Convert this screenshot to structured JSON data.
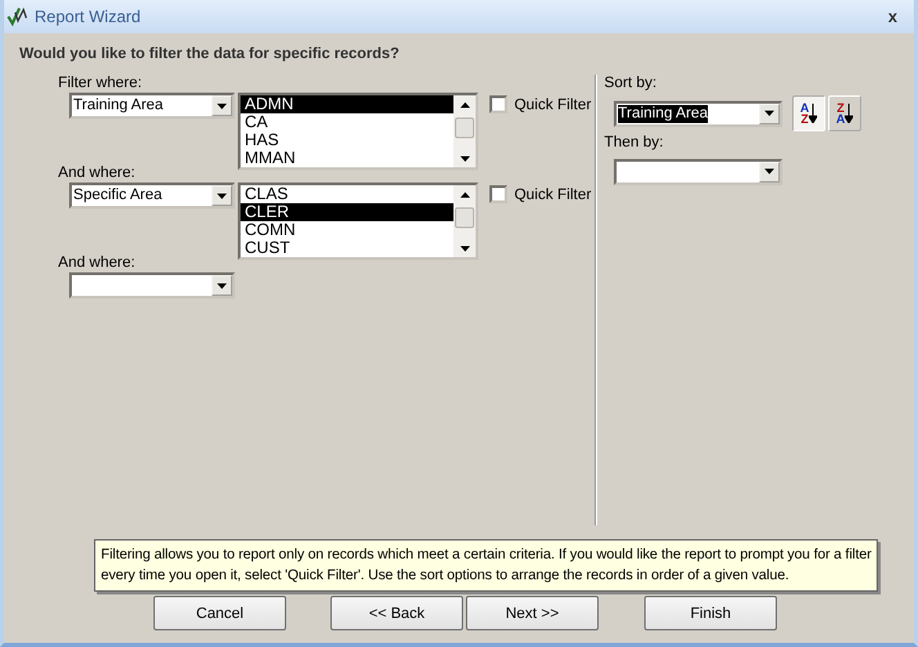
{
  "window": {
    "title": "Report Wizard",
    "close": "x"
  },
  "heading": "Would you like to filter the data for specific records?",
  "filters": [
    {
      "label": "Filter where:",
      "field": "Training Area",
      "values": [
        {
          "text": "ADMN",
          "selected": true
        },
        {
          "text": "CA",
          "selected": false
        },
        {
          "text": "HAS",
          "selected": false
        },
        {
          "text": "MMAN",
          "selected": false
        }
      ],
      "quick_filter": {
        "label": "Quick Filter",
        "checked": false
      }
    },
    {
      "label": "And where:",
      "field": "Specific Area",
      "values": [
        {
          "text": "CLAS",
          "selected": false
        },
        {
          "text": "CLER",
          "selected": true
        },
        {
          "text": "COMN",
          "selected": false
        },
        {
          "text": "CUST",
          "selected": false
        }
      ],
      "quick_filter": {
        "label": "Quick Filter",
        "checked": false
      }
    },
    {
      "label": "And where:"
    }
  ],
  "sort": {
    "label": "Sort by:",
    "field": "Training Area",
    "focused": true,
    "orders": [
      {
        "top": "A",
        "bottom": "Z",
        "selected": true
      },
      {
        "top": "Z",
        "bottom": "A",
        "selected": false
      }
    ],
    "then_label": "Then by:"
  },
  "hint": "Filtering allows you to report only on records which meet a certain criteria.  If you would like the report to prompt you for a filter every time you open it, select 'Quick Filter'.  Use the sort options to arrange the records in order of a given value.",
  "buttons": [
    "Cancel",
    "<< Back",
    "Next >>",
    "Finish"
  ]
}
